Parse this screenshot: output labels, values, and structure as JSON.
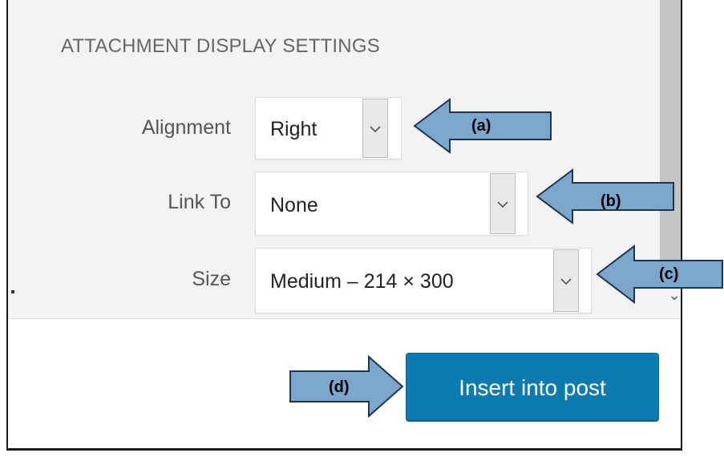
{
  "section_title": "ATTACHMENT DISPLAY SETTINGS",
  "alignment": {
    "label": "Alignment",
    "value": "Right"
  },
  "link_to": {
    "label": "Link To",
    "value": "None"
  },
  "size": {
    "label": "Size",
    "value": "Medium – 214 × 300"
  },
  "insert_button": {
    "label": "Insert into post"
  },
  "annotations": {
    "a": "(a)",
    "b": "(b)",
    "c": "(c)",
    "d": "(d)"
  },
  "colors": {
    "panel_bg": "#f3f3f3",
    "button_blue": "#0e7bb0",
    "arrow_fill": "#7da6cc",
    "scrollbar": "#c4c4c4"
  },
  "icons": [
    "chevron-down-icon",
    "arrow-left-annotation",
    "arrow-right-annotation"
  ]
}
